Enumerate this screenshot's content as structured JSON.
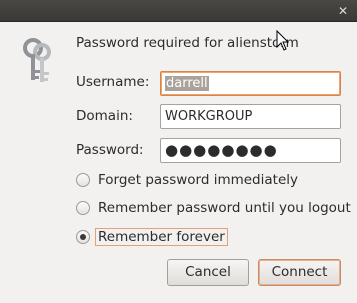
{
  "dialog": {
    "close_glyph": "✕",
    "heading": "Password required for alienstorm",
    "username_label": "Username:",
    "username_value": "darrell",
    "domain_label": "Domain:",
    "domain_value": "WORKGROUP",
    "password_label": "Password:",
    "password_value": "●●●●●●●●",
    "options": [
      {
        "label": "Forget password immediately",
        "checked": false
      },
      {
        "label": "Remember password until you logout",
        "checked": false
      },
      {
        "label": "Remember forever",
        "checked": true
      }
    ],
    "cancel_label": "Cancel",
    "connect_label": "Connect"
  },
  "icons": {
    "dialog_icon": "keys-icon",
    "pointer": "mouse-pointer-icon"
  },
  "colors": {
    "titlebar": "#3c3b37",
    "focus_accent": "#d6844c",
    "window_bg": "#f2f1f0"
  }
}
